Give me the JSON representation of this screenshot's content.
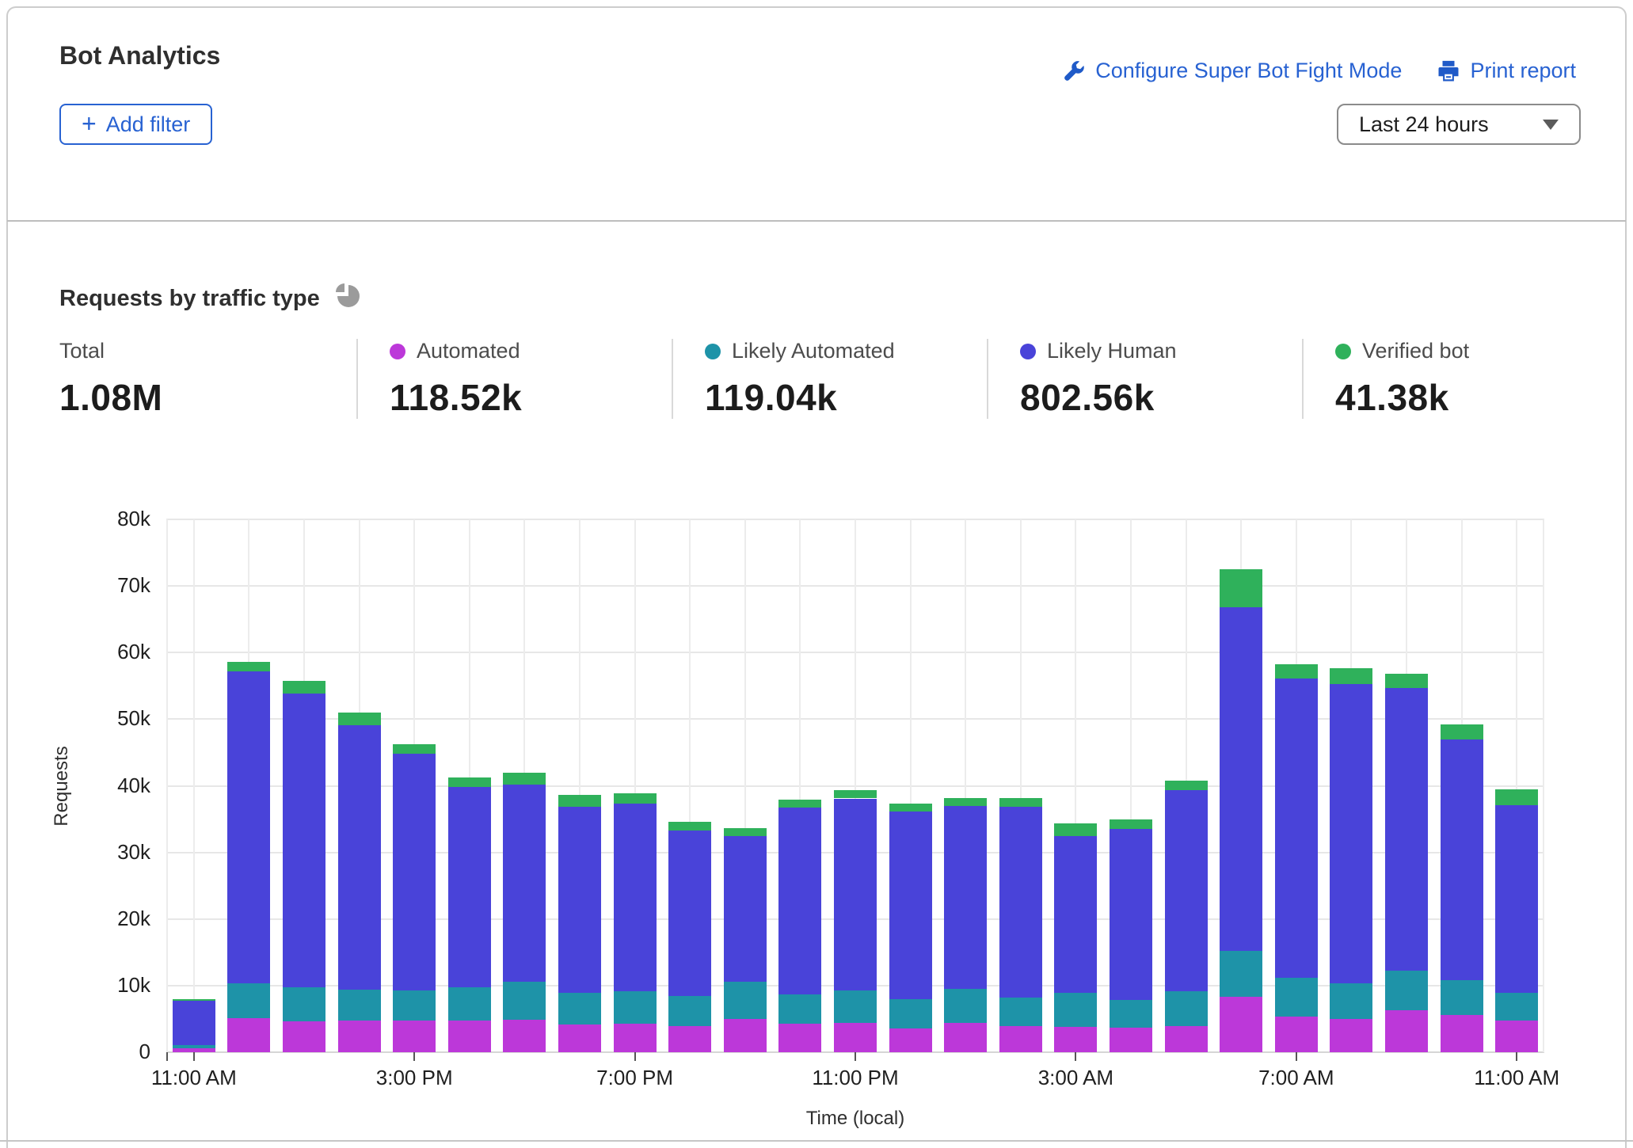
{
  "header": {
    "title": "Bot Analytics",
    "configure_label": "Configure Super Bot Fight Mode",
    "print_label": "Print report"
  },
  "filters": {
    "add_filter_plus": "+",
    "add_filter_label": "Add filter"
  },
  "time_range": {
    "selected": "Last 24 hours"
  },
  "section": {
    "title": "Requests by traffic type"
  },
  "stats": [
    {
      "label": "Total",
      "value": "1.08M",
      "color": null
    },
    {
      "label": "Automated",
      "value": "118.52k",
      "color": "#bc38d9"
    },
    {
      "label": "Likely Automated",
      "value": "119.04k",
      "color": "#1e93a8"
    },
    {
      "label": "Likely Human",
      "value": "802.56k",
      "color": "#4943d9"
    },
    {
      "label": "Verified bot",
      "value": "41.38k",
      "color": "#2fb15b"
    }
  ],
  "chart_data": {
    "type": "bar",
    "stacked": true,
    "title": "Requests by traffic type",
    "xlabel": "Time (local)",
    "ylabel": "Requests",
    "ylim": [
      0,
      80000
    ],
    "grid": true,
    "legend_position": "top-stats-row",
    "yticks": [
      {
        "value": 0,
        "label": "0"
      },
      {
        "value": 10000,
        "label": "10k"
      },
      {
        "value": 20000,
        "label": "20k"
      },
      {
        "value": 30000,
        "label": "30k"
      },
      {
        "value": 40000,
        "label": "40k"
      },
      {
        "value": 50000,
        "label": "50k"
      },
      {
        "value": 60000,
        "label": "60k"
      },
      {
        "value": 70000,
        "label": "70k"
      },
      {
        "value": 80000,
        "label": "80k"
      }
    ],
    "x_ticks": [
      {
        "index": 0,
        "label": "11:00 AM"
      },
      {
        "index": 4,
        "label": "3:00 PM"
      },
      {
        "index": 8,
        "label": "7:00 PM"
      },
      {
        "index": 12,
        "label": "11:00 PM"
      },
      {
        "index": 16,
        "label": "3:00 AM"
      },
      {
        "index": 20,
        "label": "7:00 AM"
      },
      {
        "index": 24,
        "label": "11:00 AM"
      }
    ],
    "categories": [
      "11:00 AM",
      "12:00 PM",
      "1:00 PM",
      "2:00 PM",
      "3:00 PM",
      "4:00 PM",
      "5:00 PM",
      "6:00 PM",
      "7:00 PM",
      "8:00 PM",
      "9:00 PM",
      "10:00 PM",
      "11:00 PM",
      "12:00 AM",
      "1:00 AM",
      "2:00 AM",
      "3:00 AM",
      "4:00 AM",
      "5:00 AM",
      "6:00 AM",
      "7:00 AM",
      "8:00 AM",
      "9:00 AM",
      "10:00 AM",
      "11:00 AM"
    ],
    "series": [
      {
        "name": "Automated",
        "color": "#bc38d9",
        "values": [
          600,
          5100,
          4600,
          4700,
          4800,
          4700,
          4900,
          4200,
          4300,
          3900,
          5000,
          4300,
          4400,
          3600,
          4400,
          3900,
          3800,
          3700,
          3900,
          8300,
          5300,
          5000,
          6300,
          5600,
          4700
        ]
      },
      {
        "name": "Likely Automated",
        "color": "#1e93a8",
        "values": [
          500,
          5300,
          5200,
          4700,
          4500,
          5000,
          5700,
          4700,
          4800,
          4500,
          5600,
          4400,
          4900,
          4400,
          5100,
          4300,
          5100,
          4200,
          5300,
          6900,
          5900,
          5300,
          6000,
          5200,
          4200
        ]
      },
      {
        "name": "Likely Human",
        "color": "#4943d9",
        "values": [
          6600,
          46800,
          44100,
          39700,
          35500,
          30100,
          29600,
          28000,
          28200,
          24900,
          21900,
          28000,
          28800,
          28100,
          27500,
          28700,
          23500,
          25600,
          30100,
          51600,
          44900,
          45000,
          42400,
          36200,
          28200
        ]
      },
      {
        "name": "Verified bot",
        "color": "#2fb15b",
        "values": [
          300,
          1400,
          1800,
          1900,
          1500,
          1500,
          1800,
          1700,
          1600,
          1300,
          1200,
          1200,
          1200,
          1200,
          1200,
          1300,
          1900,
          1400,
          1500,
          5700,
          2100,
          2400,
          2100,
          2200,
          2400
        ]
      }
    ]
  }
}
